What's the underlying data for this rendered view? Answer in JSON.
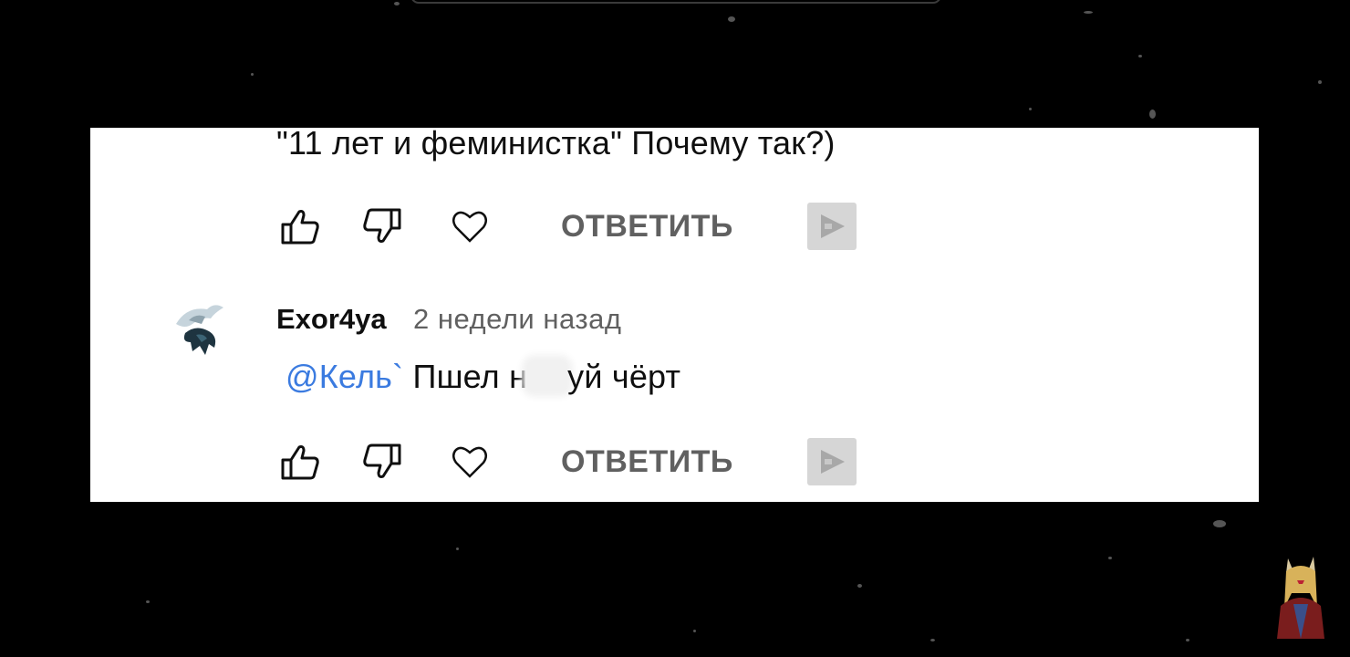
{
  "previous_comment": {
    "text_tail": "\"11 лет и феминистка\" Почему так?)",
    "actions": {
      "reply_label": "ОТВЕТИТЬ"
    }
  },
  "reply_comment": {
    "author": "Exor4ya",
    "timestamp": "2 недели назад",
    "mention": "@Кель`",
    "text_before_blur": "Пшел н",
    "text_after_blur": "уй чёрт",
    "actions": {
      "reply_label": "ОТВЕТИТЬ"
    }
  },
  "icons": {
    "like": "thumbs-up-icon",
    "dislike": "thumbs-down-icon",
    "heart": "heart-icon",
    "share": "share-icon"
  },
  "colors": {
    "background": "#000000",
    "panel": "#ffffff",
    "text": "#0f0f0f",
    "secondary_text": "#606060",
    "mention": "#3b7be0"
  }
}
